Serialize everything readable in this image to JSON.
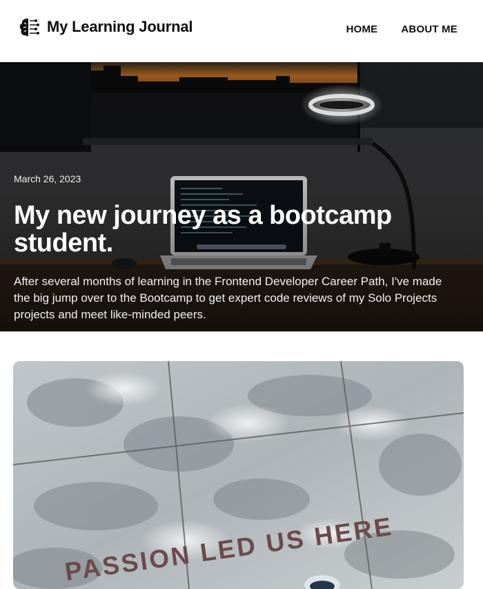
{
  "site": {
    "title": "My Learning Journal",
    "logo_icon": "brain-circuit-icon"
  },
  "nav": {
    "items": [
      {
        "label": "HOME"
      },
      {
        "label": "ABOUT ME"
      }
    ]
  },
  "hero": {
    "date": "March 26, 2023",
    "title": "My new journey as a bootcamp student.",
    "excerpt": "After several months of learning in the Frontend Developer Career Path, I've made the big jump over to the Bootcamp to get expert code reviews of my Solo Projects projects and meet like-minded peers."
  },
  "featured": {
    "image_text": "PASSION LED US HERE"
  },
  "colors": {
    "text_dark": "#0f0f0f",
    "hero_bg": "#1b1c1f",
    "sunset": "#c9782a"
  }
}
